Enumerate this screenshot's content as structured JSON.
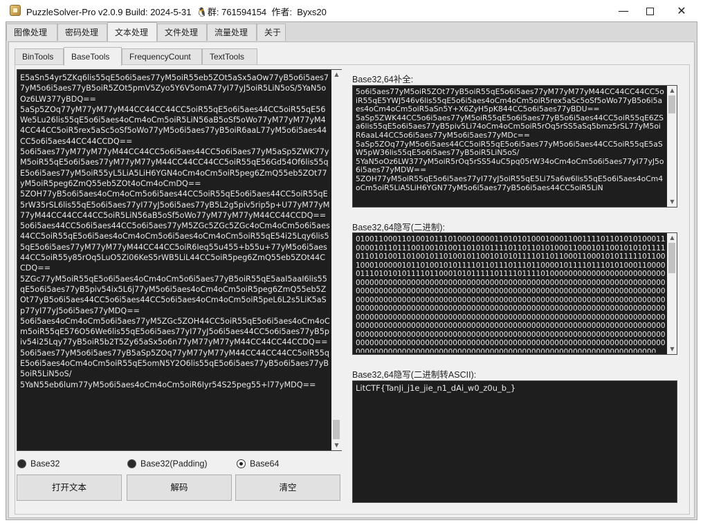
{
  "window": {
    "title": "PuzzleSolver-Pro v2.0.9 Build: 2024-5-31  🐧群: 761594154  作者:  Byxs20",
    "minimize": "—",
    "close": "✕"
  },
  "main_tabs": [
    "图像处理",
    "密码处理",
    "文本处理",
    "文件处理",
    "流量处理",
    "关于"
  ],
  "sub_tabs": [
    "BinTools",
    "BaseTools",
    "FrequencyCount",
    "TextTools"
  ],
  "input_text": "E5aSn54yr5ZKq6lis55qE5o6i5aes77yM5oiR55eb5ZOt5aSx5aOw77yB5o6i5aes77yM5o6i5aes77yB5oiR5ZOt5pmV5Zyo5Y6V5omA77yI77yJ5oiR5LiN5oS/5YaN5oOz6LW377yBDQ==\n5aSp5ZOq77yM77yM77yM44CC44CC44CC5oiR55qE5o6i5aes44CC5oiR55qE56We5Lu26lis55qE5o6i5aes4oCm4oCm5oiR5LiN56aB5oSf5oWo77yM77yM77yM44CC44CC5oiR5rex5aSc5oSf5oWo77yM5o6i5aes77yB5oiR6aaL77yM5o6i5aes44CC5o6i5aes44CC44CCDQ==\n5o6i5aes77yM77yM77yM44CC44CC5o6i5aes44CC5o6i5aes77yM5aSp5ZWK77yM5oiR55qE5o6i5aes77yM77yM77yM44CC44CC44CC5oiR55qE56Gd54Of6lis55qE5o6i5aes77yM5oiR55yL5LiA5LiH6YGN4oCm4oCm5oiR5peg6ZmQ55eb5ZOt77yM5oiR5peg6ZmQ55eb5ZOt4oCm4oCmDQ==\n5ZOH77yB5o6i5aes4oCm4oCm5o6i5aes44CC5oiR55qE5o6i5aes44CC5oiR55qE5rW35rSL6lis55qE5o6i5aes77yI77yJ5o6i5aes77yB5L2g5piv5rip5p+U77yM77yM77yM44CC44CC44CC5oiR5LiN56aB5oSf5oWo77yM77yM77yM44CC44CCDQ==\n5o6i5aes44CC5o6i5aes44CC5o6i5aes77yM5ZGc5ZGc5ZGc4oCm4oCm5o6i5aes44CC5oiR55qE5o6i5aes4oCm4oCm5o6i5aes4oCm4oCm5oiR55qE54i25Lqy6lis55qE5o6i5aes77yM77yM77yM44CC44CC5oiR6Ieq55u455+b55u+77yM5o6i5aes44CC5oiR55y85rOq5LuO5Zi06KeS5rWB5LiL44CC5oiR5peg6ZmQ55eb5ZOt44CCDQ==\n5ZGc77yM5oiR55qE5o6i5aes4oCm4oCm5o6i5aes77yB5oiR55qE5aaI5aaI6lis55qE5o6i5aes77yB5piv54ix5L6j77yM5o6i5aes4oCm4oCm5oiR5peg6ZmQ55eb5ZOt77yB5o6i5aes44CC5o6i5aes44CC5o6i5aes4oCm4oCm5oiR5peL6L2s5LiK5aSp77yI77yJ5o6i5aes77yMDQ==\n5o6i5aes4oCm4oCm5o6i5aes77yM5ZGc5ZOH44CC5oiR55qE5o6i5aes4oCm4oCm5oiR55qE576O56We6lis55qE5o6i5aes77yI77yJ5o6i5aes44CC5o6i5aes77yB5piv54i25Lqy77yB5oiR5b2T5Zy65aSx5o6n77yM77yM77yM44CC44CC44CCDQ==\n5o6i5aes77yM5o6i5aes77yB5aSp5ZOq77yM77yM77yM44CC44CC44CC5oiR55qE5o6i5aes4oCm4oCm5oiR55qE5omN5Y2O6lis55qE5o6i5aes77yB5o6i5aes77yB5oiR5LiN5oS/\n5YaN55eb6lum77yM5o6i5aes4oCm4oCm5oiR6Iyr54S25peg55+l77yMDQ==",
  "encoding_options": {
    "base32": "Base32",
    "base32_padding": "Base32(Padding)",
    "base64": "Base64",
    "selected": "Base64"
  },
  "buttons": {
    "open_text": "打开文本",
    "decode": "解码",
    "clear": "清空"
  },
  "right": {
    "padding_label": "Base32,64补全:",
    "padding_text": "5o6i5aes77yM5oiR5ZOt77yB5oiR55qE5o6i5aes77yM77yM77yM44CC44CC44CC5oiR55qE5YWJ546v6lis55qE5o6i5aes4oCm4oCm5oiR5rex5aSc5oSf5oWo77yB5o6i5aes4oCm4oCm5oiR5aSn5Y+X6ZyH5pK844CC5o6i5aes77yBDU==\n5aSp5ZWK44CC5o6i5aes77yM5oiR55qE5o6i5aes77yB5o6i5aes44CC5oiR55qE6ZSa6lis55qE5o6i5aes77yB5piv5Li74oCm4oCm5oiR5rOq5rSS5aSq5bmz5rSL77yM5oiR6aaL44CC5o6i5aes77yM5o6i5aes77yMDc==\n5aSp5ZOq77yM5o6i5aes44CC5oiR55qE5o6i5aes77yM5o6i5aes44CC5oiR55qE5aSW5pW36lis55qE5o6i5aes77yB5oiR5LiN5oS/\n5YaN5oOz6LW377yM5oiR5rOq5rSS54uC5pq05rW34oCm4oCm5o6i5aes77yI77yJ5o6i5aes77yMDW==\n5ZOH77yM5oiR55qE5o6i5aes77yI77yJ5oiR55qE5Li75a6w6lis55qE5o6i5aes4oCm4oCm5oiR5LiA5LiH6YGN77yM5o6i5aes77yB5o6i5aes44CC5oiR5LiN",
    "bin_label": "Base32,64隐写(二进制):",
    "bin_text": "010011000110100101110100010000110101010001000110011110110101010001100001011011100100101001101010111101101101010001100010110010101011110110101001101001011010010110010101011110110110001100010101111101100100010000010110100101011110110111011101100001011110111010100011000001110101010111101100010101111101111011110100000000000000000000000000000000000000000000000000000000000000000000000000000000000000000000000000000000000000000000000000000000000000000000000000000000000000000000000000000000000000000000000000000000000000000000000000000000000000000000000000000000000000000000000000000000000000000000000000000000000000000000000000000000000000000000000000000000000000000000000000000000000000000000000000000000000000000000000000000000000000000000000000000000000000000000000000000000000000000000000000000000000000000000000000000000000000000000000000000000000000000000000000000000000000000000000000000000000000000000000000000000000000000000000000",
    "ascii_label": "Base32,64隐写(二进制转ASCII):",
    "ascii_text": "LitCTF{TanJi_j1e_jie_n1_dAi_w0_z0u_b_}"
  }
}
